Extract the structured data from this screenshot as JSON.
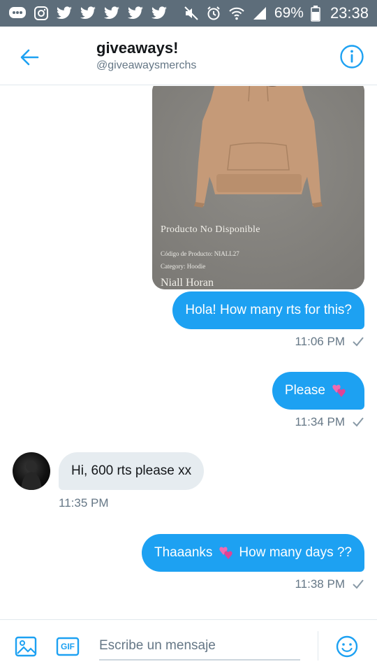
{
  "status_bar": {
    "battery": "69%",
    "time": "23:38",
    "left_icons": [
      "messages-icon",
      "instagram-icon",
      "twitter-icon",
      "twitter-icon",
      "twitter-icon",
      "twitter-icon",
      "twitter-icon"
    ],
    "right_icons": [
      "mute-icon",
      "alarm-icon",
      "wifi-icon",
      "signal-icon",
      "battery-icon"
    ]
  },
  "header": {
    "title": "giveaways!",
    "handle": "@giveawaysmerchs",
    "accent": "#1da1f2"
  },
  "media": {
    "status": "Producto No Disponible",
    "code": "Código de Producto: NIALL27",
    "category": "Category: Hoodie",
    "name": "Niall Horan"
  },
  "messages": [
    {
      "side": "sent",
      "text": "Hola! How many rts for this?",
      "time": "11:06 PM"
    },
    {
      "side": "sent",
      "text": "Please",
      "emoji": "two-hearts",
      "time": "11:34 PM"
    },
    {
      "side": "received",
      "text": "Hi, 600 rts please xx",
      "time": "11:35 PM"
    },
    {
      "side": "sent",
      "text_before": "Thaaanks",
      "emoji": "two-hearts",
      "text_after": "How many days ??",
      "time": "11:38 PM"
    }
  ],
  "composer": {
    "placeholder": "Escribe un mensaje",
    "gif_label": "GIF"
  },
  "colors": {
    "status_bar": "#5d6d7a",
    "sent_bubble": "#1da1f2",
    "received_bubble": "#e6ecf0",
    "muted_text": "#657786"
  }
}
